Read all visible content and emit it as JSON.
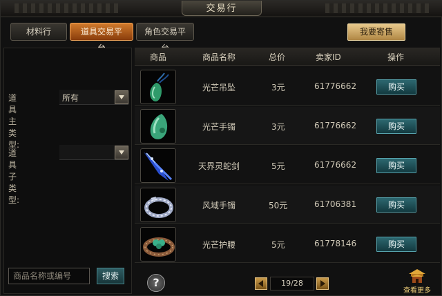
{
  "window": {
    "title": "交易行"
  },
  "tabs": [
    {
      "label": "材料行",
      "active": false
    },
    {
      "label": "道具交易平台",
      "active": true
    },
    {
      "label": "角色交易平台",
      "active": false
    }
  ],
  "sell_button": "我要寄售",
  "filters": {
    "main_type_label": "道具主类型:",
    "main_type_value": "所有",
    "sub_type_label": "道具子类型:",
    "sub_type_value": ""
  },
  "search": {
    "placeholder": "商品名称或编号",
    "button": "搜索"
  },
  "table": {
    "headers": [
      "商品",
      "商品名称",
      "总价",
      "卖家ID",
      "操作"
    ],
    "rows": [
      {
        "icon": "jade-pendant-icon",
        "name": "光芒吊坠",
        "price": "3元",
        "seller": "61776662",
        "action": "购买"
      },
      {
        "icon": "jade-bracelet-icon",
        "name": "光芒手镯",
        "price": "3元",
        "seller": "61776662",
        "action": "购买"
      },
      {
        "icon": "blue-serpent-sword-icon",
        "name": "天界灵蛇剑",
        "price": "5元",
        "seller": "61776662",
        "action": "购买"
      },
      {
        "icon": "silver-bracelet-icon",
        "name": "风域手镯",
        "price": "50元",
        "seller": "61706381",
        "action": "购买"
      },
      {
        "icon": "jade-belt-icon",
        "name": "光芒护腰",
        "price": "5元",
        "seller": "61778146",
        "action": "购买"
      }
    ]
  },
  "pager": {
    "display": "19/28"
  },
  "more": {
    "label": "查看更多"
  },
  "colors": {
    "accent_tab": "#d07a2c",
    "buy_button": "#2d6870",
    "gold": "#e8c98c"
  }
}
